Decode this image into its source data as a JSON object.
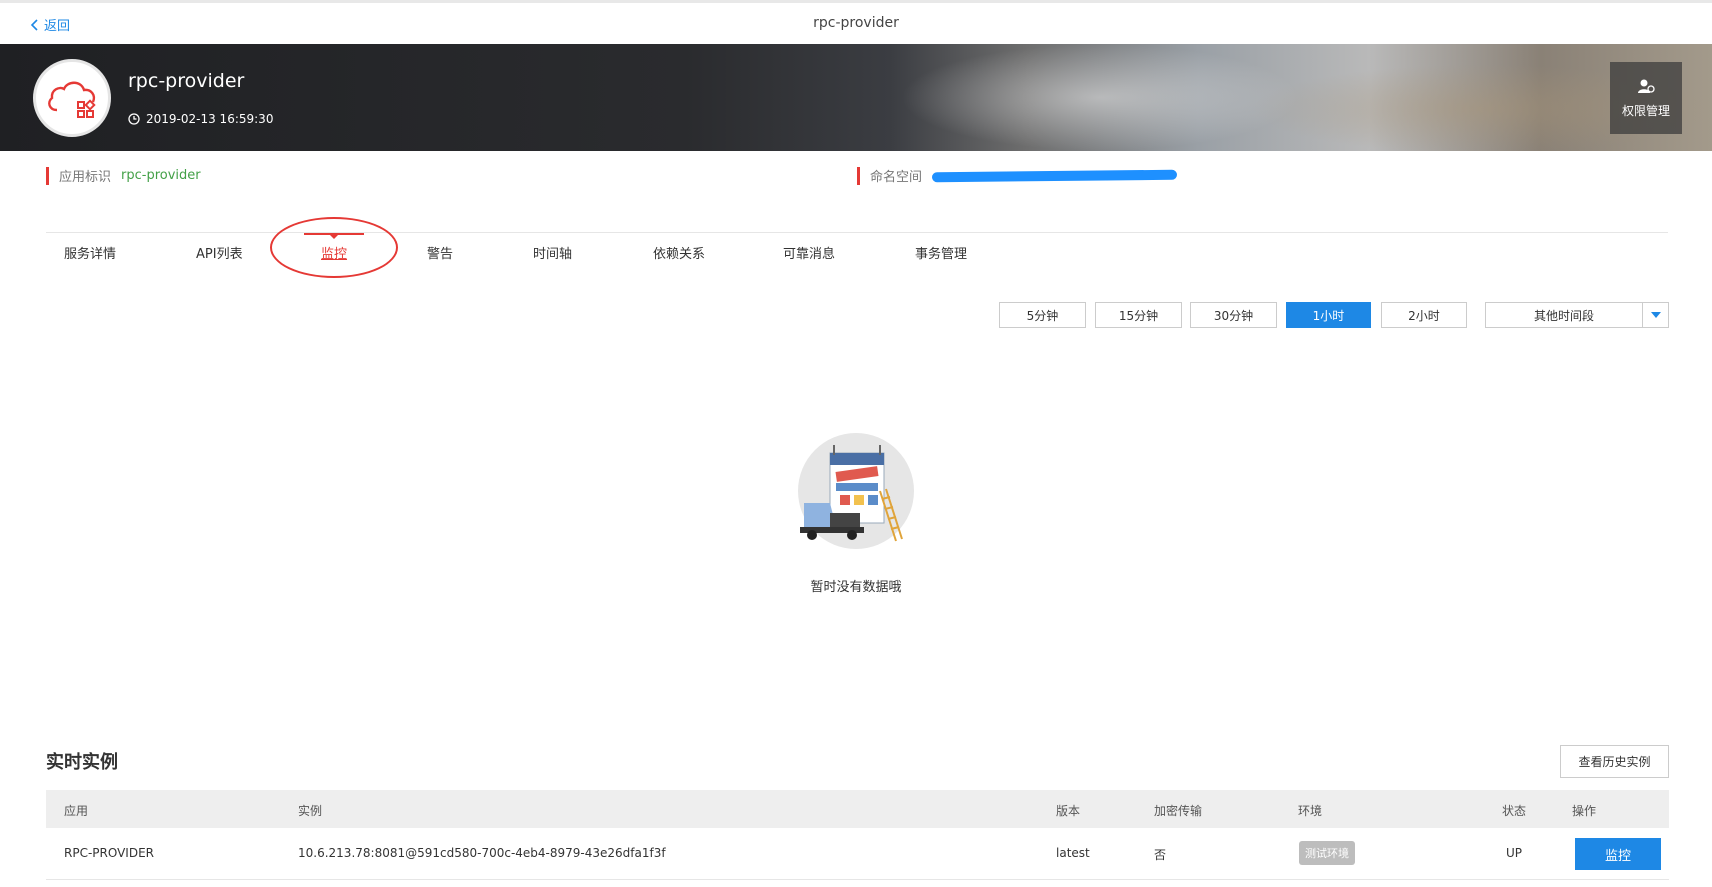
{
  "header": {
    "back_label": "返回",
    "title": "rpc-provider"
  },
  "banner": {
    "app_name": "rpc-provider",
    "created_time": "2019-02-13 16:59:30",
    "permission_label": "权限管理"
  },
  "info": {
    "app_id_label": "应用标识",
    "app_id_value": "rpc-provider",
    "namespace_label": "命名空间"
  },
  "tabs": [
    {
      "label": "服务详情"
    },
    {
      "label": "API列表"
    },
    {
      "label": "监控",
      "active": true
    },
    {
      "label": "警告"
    },
    {
      "label": "时间轴"
    },
    {
      "label": "依赖关系"
    },
    {
      "label": "可靠消息"
    },
    {
      "label": "事务管理"
    }
  ],
  "time_ranges": [
    {
      "label": "5分钟"
    },
    {
      "label": "15分钟"
    },
    {
      "label": "30分钟"
    },
    {
      "label": "1小时",
      "active": true
    },
    {
      "label": "2小时"
    }
  ],
  "other_period_label": "其他时间段",
  "empty_state": {
    "text": "暂时没有数据哦"
  },
  "realtime": {
    "title": "实时实例",
    "history_button": "查看历史实例",
    "columns": [
      "应用",
      "实例",
      "版本",
      "加密传输",
      "环境",
      "状态",
      "操作"
    ],
    "rows": [
      {
        "app": "RPC-PROVIDER",
        "instance": "10.6.213.78:8081@591cd580-700c-4eb4-8979-43e26dfa1f3f",
        "version": "latest",
        "encrypted": "否",
        "env": "测试环境",
        "status": "UP",
        "action": "监控"
      }
    ]
  },
  "colors": {
    "accent_blue": "#1e88e5",
    "accent_red": "#e53935",
    "value_green": "#43a047"
  }
}
